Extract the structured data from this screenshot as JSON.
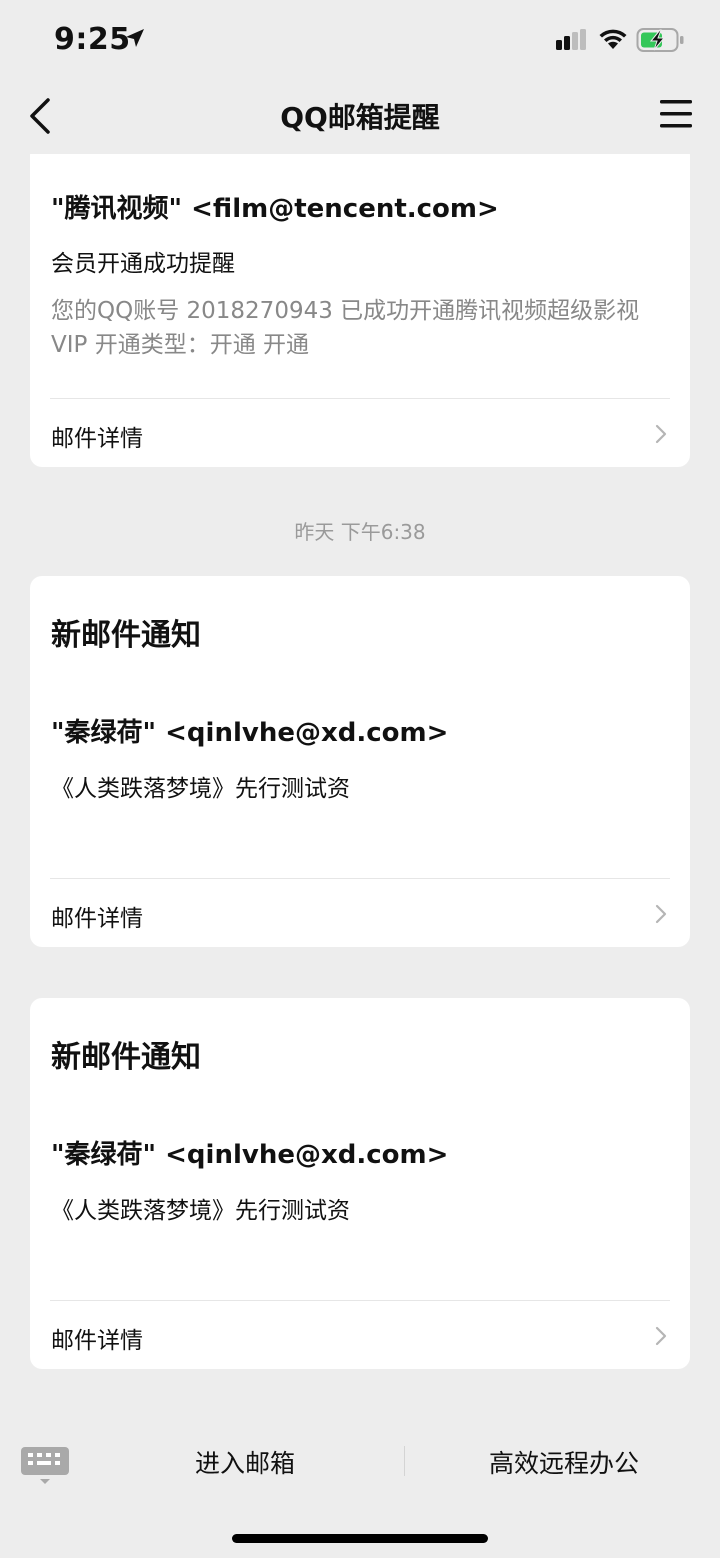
{
  "status_bar": {
    "time": "9:25"
  },
  "nav": {
    "title": "QQ邮箱提醒"
  },
  "messages": [
    {
      "sender": "\"腾讯视频\" <film@tencent.com>",
      "subject": "会员开通成功提醒",
      "body": " 您的QQ账号 2018270943 已成功开通腾讯视频超级影视 VIP 开通类型：开通 开通",
      "detail_label": "邮件详情"
    },
    {
      "timestamp": "昨天 下午6:38",
      "title": "新邮件通知",
      "sender": "\"秦绿荷\" <qinlvhe@xd.com>",
      "subject": "《人类跌落梦境》先行测试资",
      "detail_label": "邮件详情"
    },
    {
      "title": "新邮件通知",
      "sender": "\"秦绿荷\" <qinlvhe@xd.com>",
      "subject": "《人类跌落梦境》先行测试资",
      "detail_label": "邮件详情"
    }
  ],
  "bottom_menu": {
    "items": [
      "进入邮箱",
      "高效远程办公"
    ]
  },
  "colors": {
    "background": "#ededed",
    "card": "#ffffff",
    "secondary_text": "#888888",
    "battery": "#34c759"
  }
}
